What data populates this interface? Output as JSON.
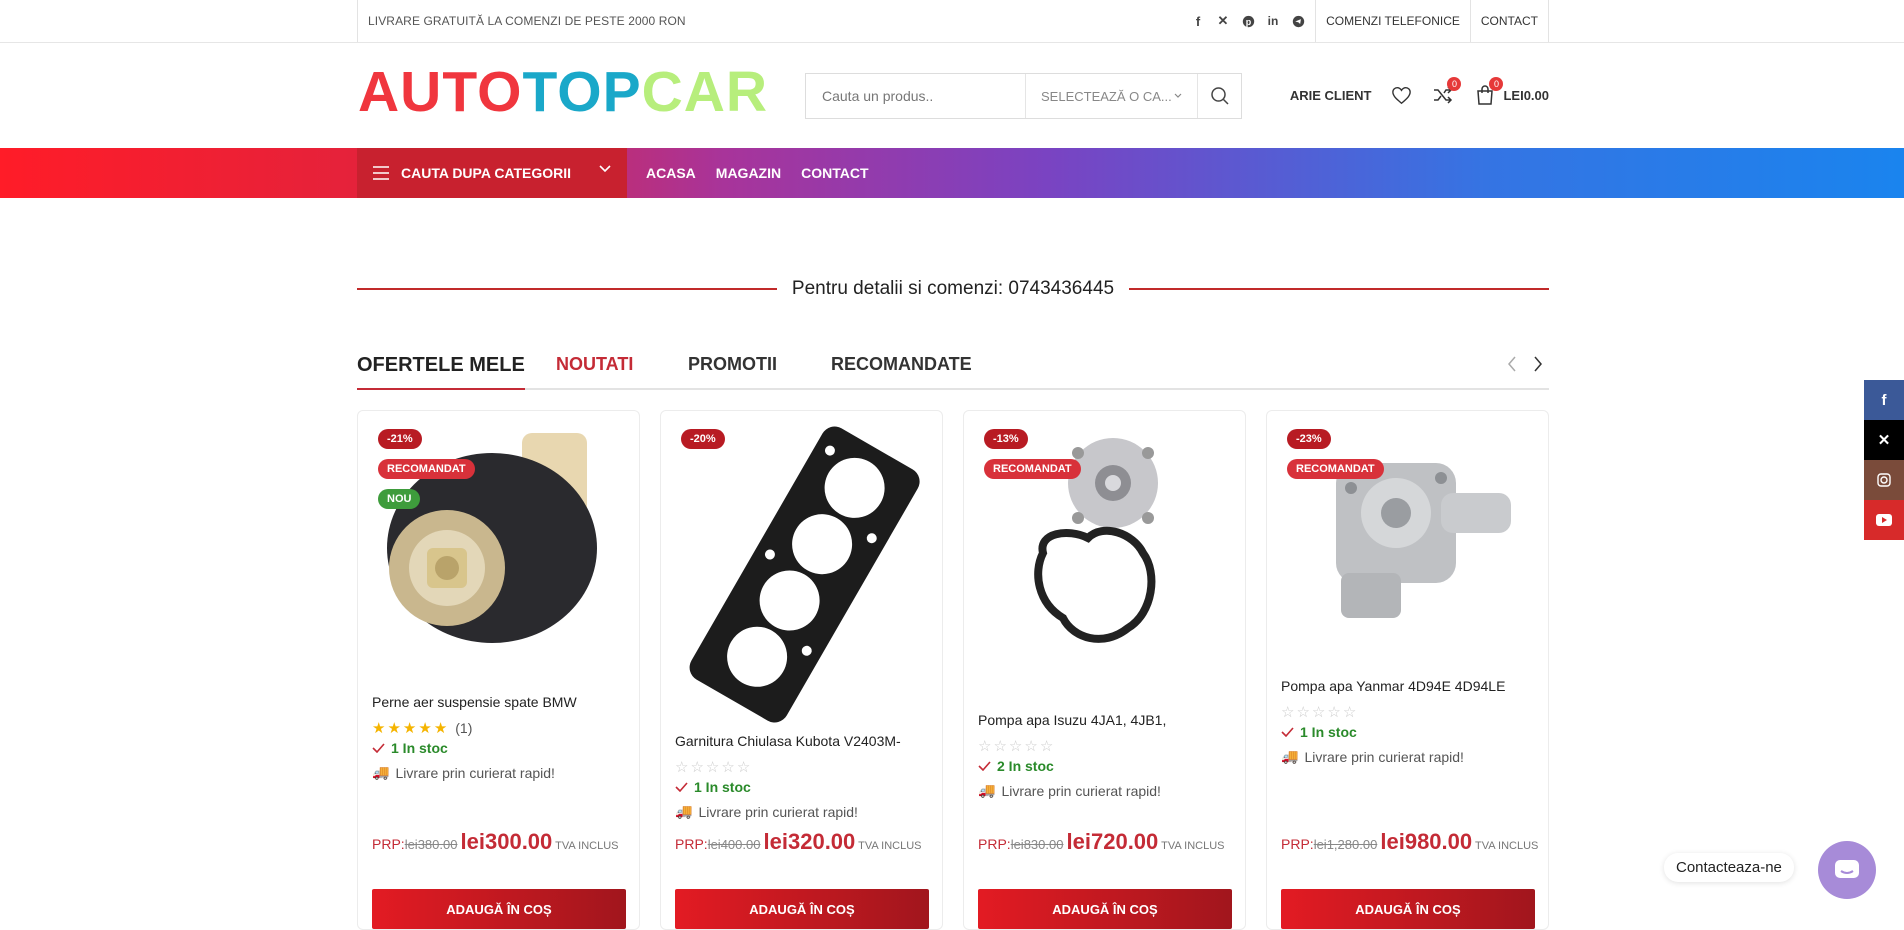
{
  "topbar": {
    "promo": "LIVRARE GRATUITĂ LA COMENZI DE PESTE 2000 RON",
    "socials": [
      "facebook-icon",
      "x-icon",
      "pinterest-icon",
      "linkedin-icon",
      "telegram-icon"
    ],
    "links": [
      "COMENZI TELEFONICE",
      "CONTACT"
    ]
  },
  "header": {
    "logo": {
      "part1": "AUTO",
      "part2": "TOP",
      "part3": "CAR"
    },
    "search_placeholder": "Cauta un produs..",
    "category_label": "SELECTEAZĂ O CA...",
    "account_label": "ARIE CLIENT",
    "wishlist_count": "",
    "compare_count": "0",
    "cart_count": "0",
    "cart_total": "LEI0.00"
  },
  "nav": {
    "categories_label": "CAUTA DUPA CATEGORII",
    "items": [
      "ACASA",
      "MAGAZIN",
      "CONTACT"
    ]
  },
  "phone_text": "Pentru detalii si comenzi: 0743436445",
  "tabs": {
    "title": "OFERTELE MELE",
    "items": [
      "NOUTATI",
      "PROMOTII",
      "RECOMANDATE"
    ]
  },
  "products": [
    {
      "discount": "-21%",
      "label2": "RECOMANDAT",
      "label3": "NOU",
      "name": "Perne aer suspensie spate BMW",
      "review_count": "(1)",
      "stock": "1 In stoc",
      "shipping": "Livrare prin curierat rapid!",
      "prp": "PRP:",
      "old_price": "lei380.00",
      "new_price": "lei300.00",
      "tva": "TVA INCLUS",
      "button": "ADAUGĂ ÎN COȘ"
    },
    {
      "discount": "-20%",
      "name": "Garnitura Chiulasa Kubota V2403M-",
      "stock": "1 In stoc",
      "shipping": "Livrare prin curierat rapid!",
      "prp": "PRP:",
      "old_price": "lei400.00",
      "new_price": "lei320.00",
      "tva": "TVA INCLUS",
      "button": "ADAUGĂ ÎN COȘ"
    },
    {
      "discount": "-13%",
      "label2": "RECOMANDAT",
      "name": "Pompa apa Isuzu 4JA1, 4JB1,",
      "stock": "2 In stoc",
      "shipping": "Livrare prin curierat rapid!",
      "prp": "PRP:",
      "old_price": "lei830.00",
      "new_price": "lei720.00",
      "tva": "TVA INCLUS",
      "button": "ADAUGĂ ÎN COȘ"
    },
    {
      "discount": "-23%",
      "label2": "RECOMANDAT",
      "name": "Pompa apa Yanmar 4D94E 4D94LE",
      "stock": "1 In stoc",
      "shipping": "Livrare prin curierat rapid!",
      "prp": "PRP:",
      "old_price": "lei1,280.00",
      "new_price": "lei980.00",
      "tva": "TVA INCLUS",
      "button": "ADAUGĂ ÎN COȘ"
    }
  ],
  "side_social": [
    "facebook-icon",
    "x-icon",
    "instagram-icon",
    "youtube-icon"
  ],
  "contact_chip": "Contacteaza-ne",
  "colors": {
    "accent": "#c42b36",
    "stock_green": "#2a8a2a",
    "star": "#f5b400"
  }
}
